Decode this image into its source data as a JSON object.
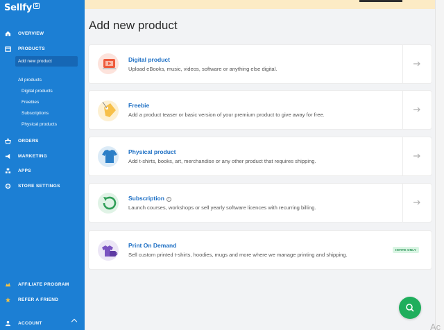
{
  "app": {
    "logo_text": "Sellfy",
    "logo_badge": "S"
  },
  "sidebar": {
    "overview": "OVERVIEW",
    "products": "PRODUCTS",
    "add_new_product": "Add new product",
    "all_products": "All products",
    "digital_products": "Digital products",
    "freebies": "Freebies",
    "subscriptions": "Subscriptions",
    "physical_products": "Physical products",
    "orders": "ORDERS",
    "marketing": "MARKETING",
    "apps": "APPS",
    "store_settings": "STORE SETTINGS",
    "affiliate_program": "AFFILIATE PROGRAM",
    "refer_a_friend": "REFER A FRIEND",
    "account": "ACCOUNT"
  },
  "main": {
    "title": "Add new product",
    "cards": [
      {
        "title": "Digital product",
        "desc": "Upload eBooks, music, videos, software or anything else digital."
      },
      {
        "title": "Freebie",
        "desc": "Add a product teaser or basic version of your premium product to give away for free."
      },
      {
        "title": "Physical product",
        "desc": "Add t-shirts, books, art, merchandise or any other product that requires shipping."
      },
      {
        "title": "Subscription",
        "desc": "Launch courses, workshops or sell yearly software licences with recurring billing."
      },
      {
        "title": "Print On Demand",
        "desc": "Sell custom printed t-shirts, hoodies, mugs and more where we manage printing and shipping.",
        "badge": "INVITE ONLY"
      }
    ]
  },
  "overlay": {
    "ac_text": "Ac"
  },
  "colors": {
    "sidebar": "#1c7fd4",
    "accent": "#1d6fc4",
    "chat": "#1fae5c",
    "banner": "#fcebc5"
  }
}
